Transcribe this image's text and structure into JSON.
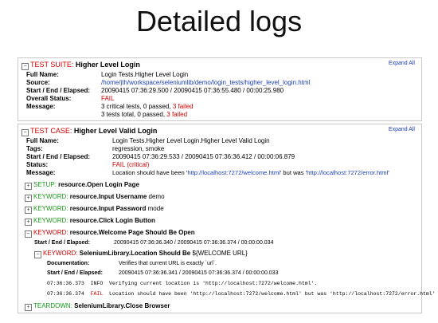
{
  "slide_title": "Detailed logs",
  "expand_all": "Expand All",
  "suite": {
    "toggle": "−",
    "kind": "TEST SUITE:",
    "name": "Higher Level Login",
    "fields": {
      "full_name_label": "Full Name:",
      "full_name": "Login Tests.Higher Level Login",
      "source_label": "Source:",
      "source": "/home/jth/workspace/seleniumlib/demo/login_tests/higher_level_login.html",
      "times_label": "Start / End / Elapsed:",
      "times": "20090415 07:36:29.500  /  20090415 07:36:55.480  /  00:00:25.980",
      "status_label": "Overall Status:",
      "status": "FAIL",
      "message_label": "Message:",
      "msg1_a": "3 critical tests, 0 passed, ",
      "msg1_b": "3 failed",
      "msg2_a": "3 tests total, 0 passed, ",
      "msg2_b": "3 failed"
    }
  },
  "test": {
    "toggle": "−",
    "kind": "TEST CASE:",
    "name": "Higher Level Valid Login",
    "fields": {
      "full_name_label": "Full Name:",
      "full_name": "Login Tests.Higher Level Login.Higher Level Valid Login",
      "tags_label": "Tags:",
      "tags": "regression, smoke",
      "times_label": "Start / End / Elapsed:",
      "times": "20090415 07:36:29.533  /  20090415 07:36:36.412  /  00:00:06.879",
      "status_label": "Status:",
      "status": "FAIL (critical)",
      "message_label": "Message:",
      "msg_a": "Location should have been '",
      "msg_url1": "http://localhost:7272/welcome.html",
      "msg_b": "' but was '",
      "msg_url2": "http://localhost:7272/error.html",
      "msg_c": "'"
    },
    "keywords": [
      {
        "toggle": "+",
        "kind": "SETUP:",
        "name": "resource.Open Login Page",
        "args": ""
      },
      {
        "toggle": "+",
        "kind": "KEYWORD:",
        "name": "resource.Input Username",
        "args": "demo"
      },
      {
        "toggle": "+",
        "kind": "KEYWORD:",
        "name": "resource.Input Password",
        "args": "mode"
      },
      {
        "toggle": "+",
        "kind": "KEYWORD:",
        "name": "resource.Click Login Button",
        "args": ""
      },
      {
        "toggle": "−",
        "kind": "KEYWORD:",
        "name": "resource.Welcome Page Should Be Open",
        "args": ""
      }
    ],
    "welcome": {
      "times_label": "Start / End / Elapsed:",
      "times": "20090415 07:36:36.340  /  20090415 07:36:36.374  /  00:00:00.034",
      "sub": {
        "toggle": "−",
        "kind": "KEYWORD:",
        "name": "SeleniumLibrary.Location Should Be",
        "args": "${WELCOME URL}",
        "doc_label": "Documentation:",
        "doc": "Verifies that current URL is exactly `url`.",
        "times_label": "Start / End / Elapsed:",
        "times": "20090415 07:36:36.341  /  20090415 07:36:36.374  /  00:00:00.033",
        "log1_time": "07:36:36.373",
        "log1_level": "INFO",
        "log1_msg": "Verifying current location is 'http://localhost:7272/welcome.html'.",
        "log2_time": "07:36:36.374",
        "log2_level": "FAIL",
        "log2_msg": "Location should have been 'http://localhost:7272/welcome.html' but was 'http://localhost:7272/error.html'"
      }
    },
    "teardown": {
      "toggle": "+",
      "kind": "TEARDOWN:",
      "name": "SeleniumLibrary.Close Browser"
    }
  }
}
